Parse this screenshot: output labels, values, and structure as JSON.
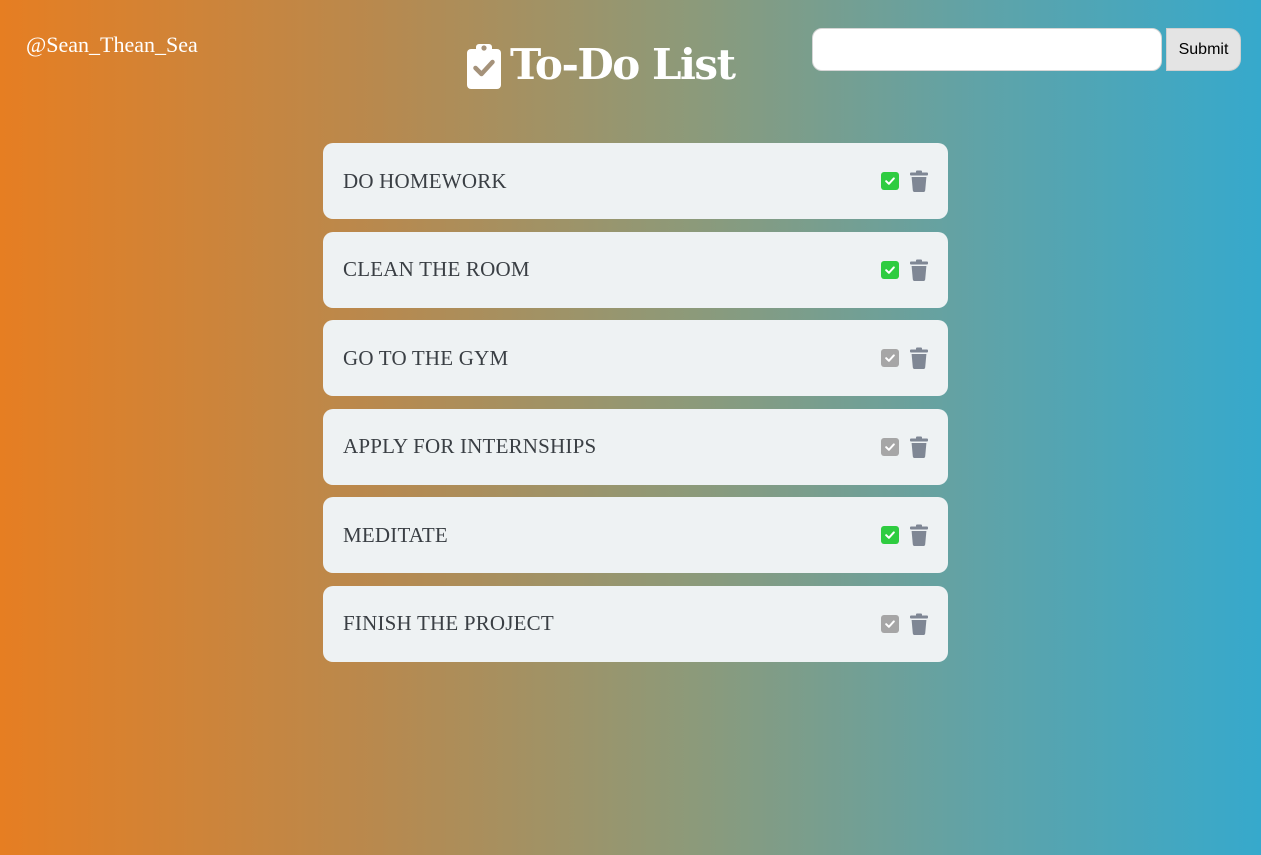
{
  "header": {
    "handle": "@Sean_Thean_Sea",
    "title": "To-Do List",
    "title_icon": "clipboard-check-icon"
  },
  "search": {
    "value": "",
    "placeholder": "",
    "submit_label": "Submit"
  },
  "todos": [
    {
      "text": "DO HOMEWORK",
      "done": true
    },
    {
      "text": "CLEAN THE ROOM",
      "done": true
    },
    {
      "text": "GO TO THE GYM",
      "done": false
    },
    {
      "text": "APPLY FOR INTERNSHIPS",
      "done": false
    },
    {
      "text": "MEDITATE",
      "done": true
    },
    {
      "text": "FINISH THE PROJECT",
      "done": false
    }
  ],
  "icons": {
    "check": "check-icon",
    "delete": "trash-icon"
  },
  "colors": {
    "gradient_left": "#e67e22",
    "gradient_right": "#36a9cc",
    "item_background": "#eef2f3",
    "check_done": "#2ecc40",
    "check_pending": "#a6a6a6",
    "trash": "#7f8794",
    "text": "#3a3f44"
  }
}
